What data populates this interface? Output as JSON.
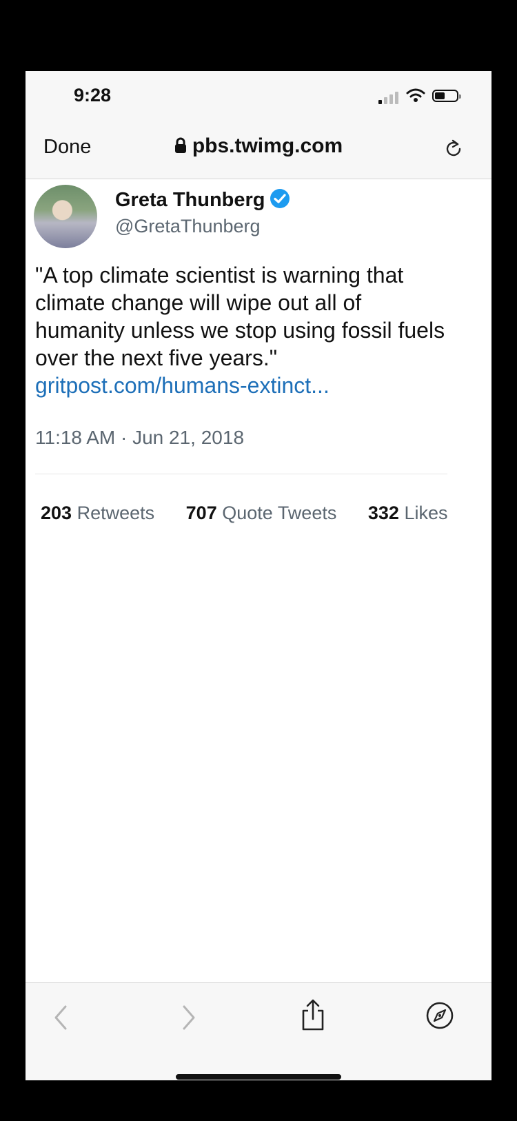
{
  "status_bar": {
    "time": "9:28"
  },
  "nav_bar": {
    "done_label": "Done",
    "url": "pbs.twimg.com"
  },
  "tweet": {
    "author_name": "Greta Thunberg",
    "handle": "@GretaThunberg",
    "text": "\"A top climate scientist is warning that climate change will wipe out all of humanity unless we stop using fossil fuels over the next five years.\"",
    "link": "gritpost.com/humans-extinct...",
    "timestamp": "11:18 AM · Jun 21, 2018",
    "stats": [
      {
        "count": "203",
        "label": "Retweets"
      },
      {
        "count": "707",
        "label": "Quote Tweets"
      },
      {
        "count": "332",
        "label": "Likes"
      }
    ]
  },
  "colors": {
    "link": "#1d6fb8",
    "verified": "#1d9bf0",
    "muted_text": "#5b6670",
    "bar_bg": "#f7f7f7"
  },
  "icons": [
    "lock-icon",
    "reload-icon",
    "verified-badge-icon",
    "back-icon",
    "forward-icon",
    "share-icon",
    "compass-icon"
  ]
}
